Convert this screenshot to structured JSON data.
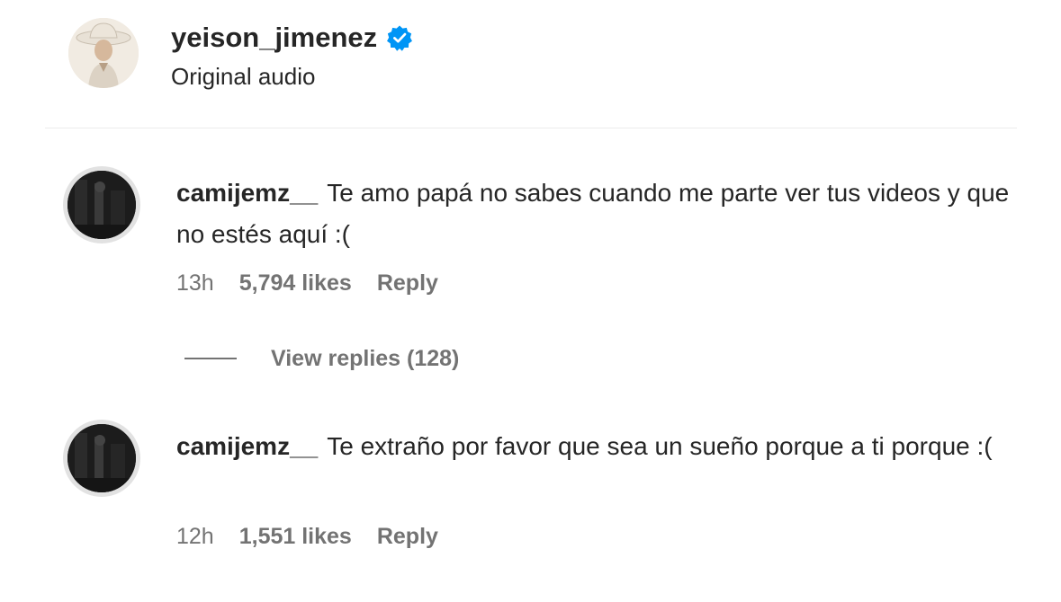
{
  "header": {
    "username": "yeison_jimenez",
    "subtitle": "Original audio",
    "verified_icon": "verified-badge-icon",
    "verified_color": "#0095f6"
  },
  "comments": [
    {
      "username": "camijemz__",
      "text": "Te amo papá no sabes cuando me parte ver tus videos y que no estés aquí :(",
      "time": "13h",
      "likes": "5,794 likes",
      "reply_label": "Reply"
    },
    {
      "username": "camijemz__",
      "text": "Te extraño por favor que sea un sueño porque a ti porque :(",
      "time": "12h",
      "likes": "1,551 likes",
      "reply_label": "Reply"
    }
  ],
  "view_replies": {
    "label": "View replies (128)"
  },
  "colors": {
    "text_primary": "#262626",
    "text_secondary": "#737373",
    "divider": "#ececec"
  }
}
